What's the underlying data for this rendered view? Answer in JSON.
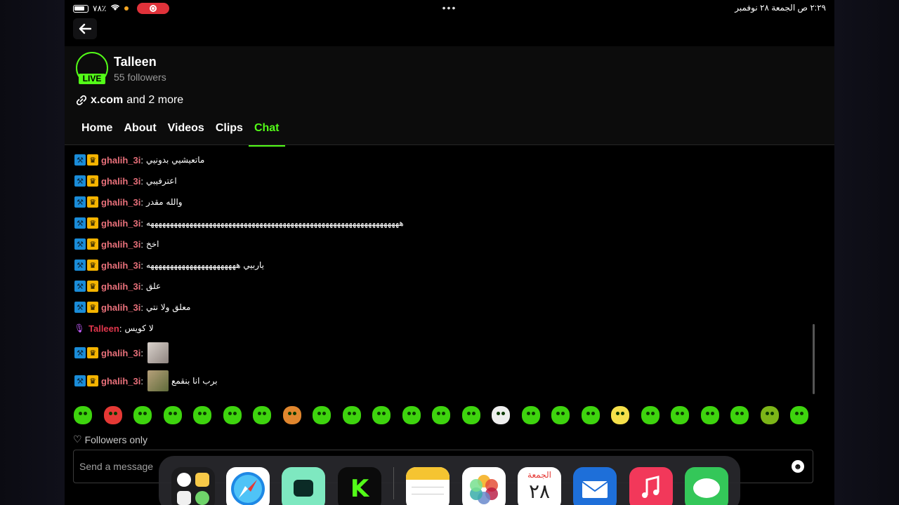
{
  "status_bar": {
    "battery": "٧٨٪",
    "time_date": "٢:٢٩ ص   الجمعة ٢٨ نوفمبر",
    "multitask_dots": "•••"
  },
  "channel": {
    "name": "Talleen",
    "followers": "55 followers",
    "live_label": "LIVE",
    "link_primary": "x.com",
    "link_more": "and 2 more"
  },
  "tabs": [
    "Home",
    "About",
    "Videos",
    "Clips",
    "Chat"
  ],
  "active_tab": "Chat",
  "colors": {
    "accent": "#53fc18",
    "username_user": "#e8707a",
    "username_broadcaster": "#e0364c"
  },
  "chat": {
    "messages": [
      {
        "user": "ghalih_3i",
        "sep": ":",
        "text": "ماتعيشيي بدونيي",
        "badges": [
          "moderator",
          "vip"
        ]
      },
      {
        "user": "ghalih_3i",
        "sep": ":",
        "text": "اعترفيبي",
        "badges": [
          "moderator",
          "vip"
        ]
      },
      {
        "user": "ghalih_3i",
        "sep": ":",
        "text": "والله مقدر",
        "badges": [
          "moderator",
          "vip"
        ]
      },
      {
        "user": "ghalih_3i",
        "sep": ":",
        "text": "هههههههههههههههههههههههههههههههههههههههههههههههههههههههههههههههههه",
        "badges": [
          "moderator",
          "vip"
        ]
      },
      {
        "user": "ghalih_3i",
        "sep": ":",
        "text": "اخخ",
        "badges": [
          "moderator",
          "vip"
        ]
      },
      {
        "user": "ghalih_3i",
        "sep": ":",
        "text": "ياربيي هههههههههههههههههههههههه",
        "badges": [
          "moderator",
          "vip"
        ]
      },
      {
        "user": "ghalih_3i",
        "sep": ":",
        "text": "علق",
        "badges": [
          "moderator",
          "vip"
        ]
      },
      {
        "user": "ghalih_3i",
        "sep": ":",
        "text": "معلق ولا نتي",
        "badges": [
          "moderator",
          "vip"
        ]
      },
      {
        "user": "Talleen",
        "sep": ":",
        "text": "لا كويس",
        "badges": [
          "broadcaster"
        ]
      },
      {
        "user": "ghalih_3i",
        "sep": ":",
        "text": "",
        "badges": [
          "moderator",
          "vip"
        ],
        "image": "sticker"
      },
      {
        "user": "ghalih_3i",
        "sep": ":",
        "text": "برب انا بنقمع",
        "badges": [
          "moderator",
          "vip"
        ],
        "image": "sticker"
      }
    ]
  },
  "emote_bar_count": 25,
  "followers_only_label": "Followers only",
  "input": {
    "placeholder": "Send a message"
  },
  "dock": {
    "calendar_day_name": "الجمعة",
    "calendar_day_number": "٢٨",
    "apps": [
      "Clock",
      "Safari",
      "Streamlabs",
      "Kick",
      "Notes",
      "Photos",
      "Calendar",
      "Mail",
      "Music",
      "Messages"
    ]
  }
}
